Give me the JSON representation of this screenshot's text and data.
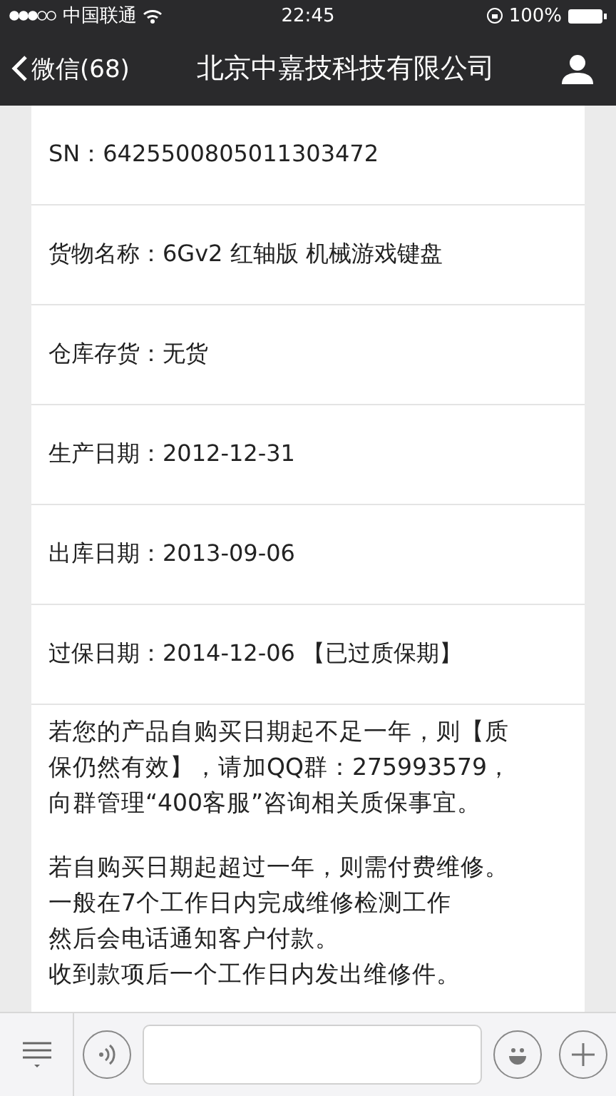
{
  "status_bar": {
    "carrier": "中国联通",
    "time": "22:45",
    "battery": "100%"
  },
  "nav": {
    "back": "微信(68)",
    "title": "北京中嘉技科技有限公司"
  },
  "rows": [
    {
      "text": "SN：6425500805011303472"
    },
    {
      "text": "货物名称：6Gv2 红轴版 机械游戏键盘"
    },
    {
      "text": "仓库存货：无货"
    },
    {
      "text": "生产日期：2012-12-31"
    },
    {
      "text": "出库日期：2013-09-06"
    },
    {
      "text": "过保日期：2014-12-06 【已过质保期】"
    }
  ],
  "paragraphs": [
    [
      "若您的产品自购买日期起不足一年，则【质",
      "保仍然有效】，请加QQ群：275993579，",
      "向群管理“400客服”咨询相关质保事宜。"
    ],
    [
      "若自购买日期起超过一年，则需付费维修。",
      "一般在7个工作日内完成维修检测工作",
      "然后会电话通知客户付款。",
      "收到款项后一个工作日内发出维修件。"
    ]
  ]
}
